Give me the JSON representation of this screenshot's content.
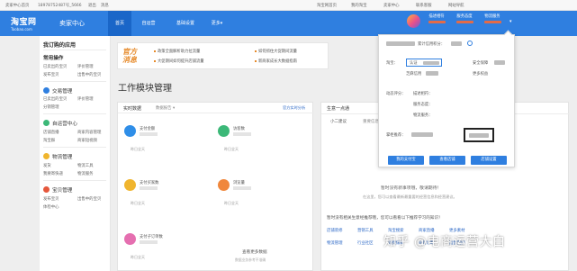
{
  "topbar": {
    "left1": "卖家中心首页",
    "user": "18978752487号_5666",
    "logout": "退出",
    "msg": "消息",
    "right": [
      "淘宝网首页",
      "我的淘宝",
      "卖家中心",
      "联系客服",
      "网站导航"
    ]
  },
  "nav": {
    "logo": "淘宝网",
    "logo_sub": "Taobao.com",
    "seller_center": "卖家中心",
    "tabs": [
      "首页",
      "自运营",
      "基础设置",
      "更多"
    ],
    "more_caret": "▾",
    "stats": [
      "描述相符",
      "服务态度",
      "物流服务"
    ]
  },
  "sidebar": {
    "title": "我订购的应用",
    "common_title": "常用操作",
    "common_items": [
      "已卖出的宝贝",
      "评价管理",
      "发布宝贝",
      "出售中的宝贝"
    ],
    "sections": [
      {
        "name": "交易管理",
        "items": [
          "已卖出的宝贝",
          "评价管理",
          "分销管理"
        ]
      },
      {
        "name": "自运营中心",
        "items": [
          "店铺直播",
          "商家内容管理",
          "淘宝群",
          "商家短视频"
        ]
      },
      {
        "name": "物流管理",
        "items": [
          "发货",
          "物流工具",
          "我要寄快递",
          "物流服务"
        ]
      },
      {
        "name": "宝贝管理",
        "items": [
          "发布宝贝",
          "出售中的宝贝",
          "体检中心"
        ]
      }
    ]
  },
  "banner": {
    "title1": "官方",
    "title2": "消息",
    "items": [
      "政策全面解析助力拉流量",
      "如何抓住大促期间流量",
      "大促期间如何提升店铺流量",
      "新商家成长大数据指南"
    ]
  },
  "workspace": {
    "title": "工作模块管理"
  },
  "realtime": {
    "title": "实时数据",
    "tab2": "数据报告 ▾",
    "link": "官方实时分析",
    "metrics": [
      {
        "label": "支付金额",
        "prev": "昨日全天",
        "color": "#2f8ee8"
      },
      {
        "label": "访客数",
        "prev": "昨日全天",
        "color": "#3cb878"
      },
      {
        "label": "支付买家数",
        "prev": "昨日全天",
        "color": "#f0b52e"
      },
      {
        "label": "浏览量",
        "prev": "昨日全天",
        "color": "#f0873c"
      },
      {
        "label": "支付子订单数",
        "prev": "昨日全天",
        "color": "#e56fb0"
      }
    ],
    "footer": "查看更多数据",
    "footer_sub": "数据业务参考不准确"
  },
  "growth": {
    "title": "生意一点通",
    "tabs": [
      "小二建议",
      "重要信息"
    ],
    "empty1": "暂时没有新事项哦，敬请期待！",
    "empty2": "在这里，您可以查看最新最重要的经营信息和经营建议。",
    "tip": "暂时没有相关生意经推荐哦，您可以看看以下推荐学习的知识！",
    "links": [
      [
        "店铺装修",
        "营销工具",
        "淘宝搜索",
        "商家直播",
        "更多素材"
      ],
      [
        "物流管理",
        "行业社区",
        "消费保障",
        "同行诊断",
        "运营案例"
      ]
    ]
  },
  "popover": {
    "rating": "累计信用积分：",
    "hao": "淘宝：",
    "cert_link": "认证",
    "zhima": "芝麻信用",
    "security": "安全保障",
    "biz_rating": "更多权益",
    "dsr_title": "动态评分：",
    "dsr_items": [
      "描述相符：",
      "服务态度：",
      "物流服务："
    ],
    "guarantee": "掌柜推荐：",
    "btns": [
      "我的支付宝",
      "查看店铺",
      "店铺设置"
    ]
  },
  "watermark": "知乎 @电商运营大白",
  "colors": {
    "brand_blue": "#2f7fe0",
    "active_blue": "#1a66c8",
    "orange": "#e68a2a"
  }
}
